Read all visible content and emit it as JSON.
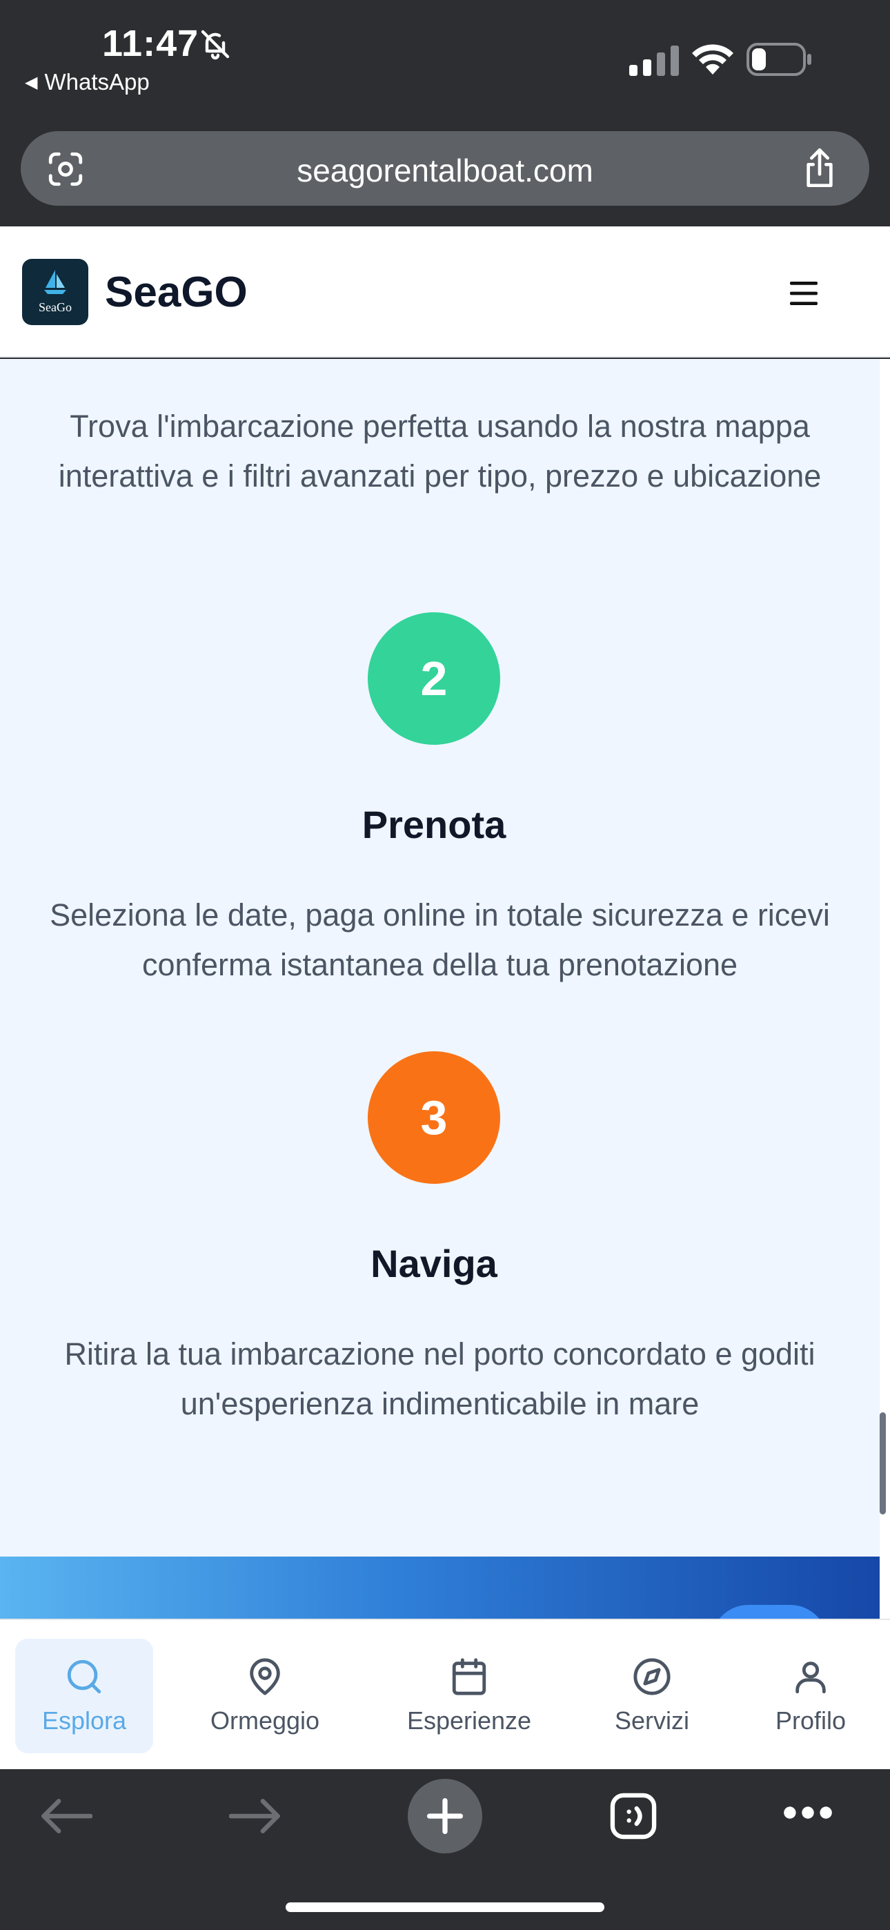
{
  "status_bar": {
    "time": "11:47",
    "back_app": "WhatsApp",
    "icons": [
      "bell-slash-icon",
      "signal-icon",
      "wifi-icon",
      "battery-icon"
    ]
  },
  "browser": {
    "url": "seagorentalboat.com",
    "icons": [
      "lens-icon",
      "share-icon"
    ]
  },
  "header": {
    "logo_text": "SeaGo",
    "brand": "SeaGO",
    "menu_icon": "hamburger-icon"
  },
  "steps": {
    "intro_desc": "Trova l'imbarcazione perfetta usando la nostra mappa interattiva e i filtri avanzati per tipo, prezzo e ubicazione",
    "items": [
      {
        "number": "2",
        "title": "Prenota",
        "desc": "Seleziona le date, paga online in totale sicurezza e ricevi conferma istantanea della tua prenotazione",
        "color": "#34d399"
      },
      {
        "number": "3",
        "title": "Naviga",
        "desc": "Ritira la tua imbarcazione nel porto concordato e goditi un'esperienza indimenticabile in mare",
        "color": "#f97316"
      }
    ]
  },
  "bottom_nav": {
    "items": [
      {
        "label": "Esplora",
        "icon": "search-icon",
        "active": true
      },
      {
        "label": "Ormeggio",
        "icon": "map-pin-icon",
        "active": false
      },
      {
        "label": "Esperienze",
        "icon": "calendar-icon",
        "active": false
      },
      {
        "label": "Servizi",
        "icon": "compass-icon",
        "active": false
      },
      {
        "label": "Profilo",
        "icon": "user-icon",
        "active": false
      }
    ]
  },
  "toolbar": {
    "icons": [
      "back-arrow-icon",
      "forward-arrow-icon",
      "plus-icon",
      "tabs-icon",
      "more-icon"
    ]
  },
  "colors": {
    "accent": "#5aa9e6",
    "page_bg": "#eff6ff",
    "step2": "#34d399",
    "step3": "#f97316"
  }
}
